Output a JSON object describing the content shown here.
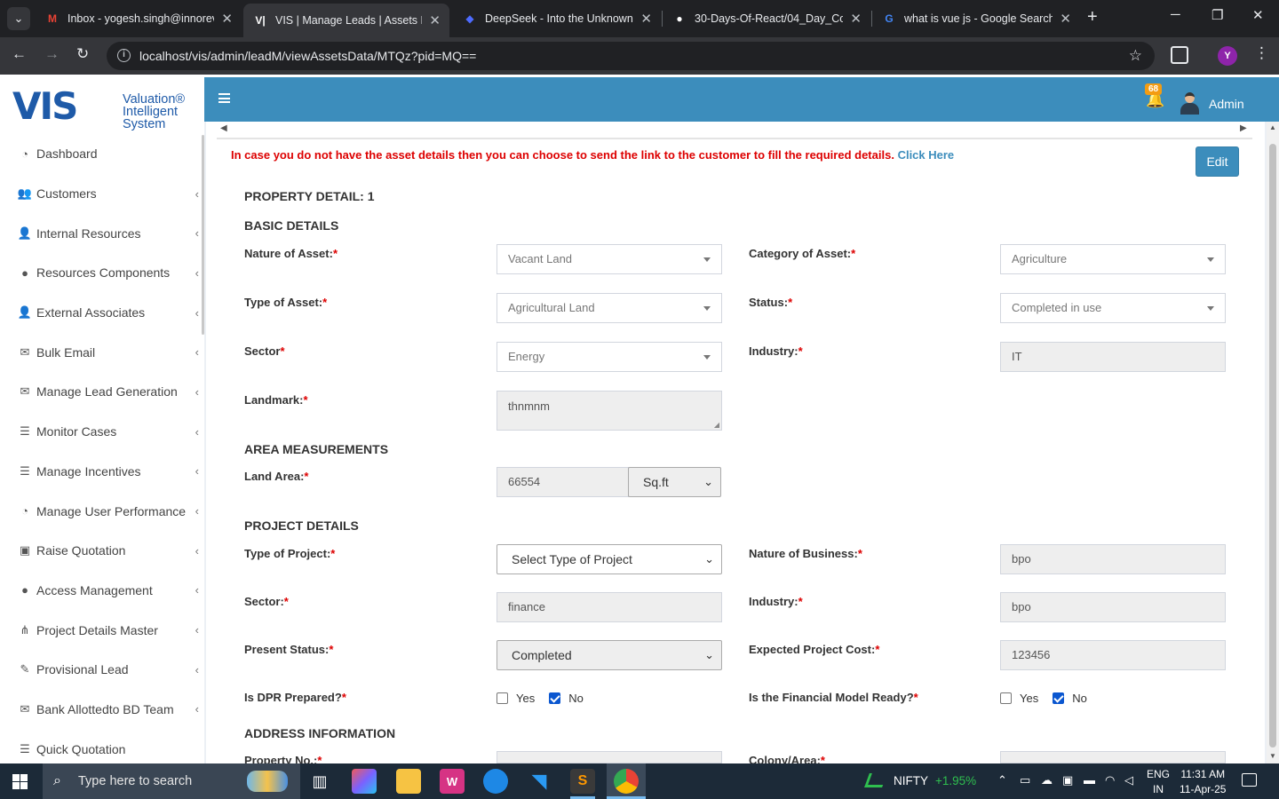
{
  "browser": {
    "tabs": [
      {
        "label": "Inbox - yogesh.singh@innorev",
        "icon": "gmail-icon"
      },
      {
        "label": "VIS | Manage Leads | Assets De",
        "icon": "vis-icon"
      },
      {
        "label": "DeepSeek - Into the Unknown",
        "icon": "deepseek-icon"
      },
      {
        "label": "30-Days-Of-React/04_Day_Com",
        "icon": "github-icon"
      },
      {
        "label": "what is vue js - Google Search",
        "icon": "google-icon"
      }
    ],
    "url": "localhost/vis/admin/leadM/viewAssetsData/MTQz?pid=MQ==",
    "profile_initial": "Y"
  },
  "logo": {
    "mark": "VIS",
    "line1": "Valuation®",
    "line2": "Intelligent",
    "line3": "System"
  },
  "sidebar": {
    "items": [
      {
        "label": "Dashboard",
        "icon": "dashboard-icon"
      },
      {
        "label": "Customers",
        "icon": "users-icon"
      },
      {
        "label": "Internal Resources",
        "icon": "user-plus-icon"
      },
      {
        "label": "Resources Components",
        "icon": "globe-icon"
      },
      {
        "label": "External Associates",
        "icon": "user-icon"
      },
      {
        "label": "Bulk Email",
        "icon": "envelope-icon"
      },
      {
        "label": "Manage Lead Generation",
        "icon": "envelope-icon"
      },
      {
        "label": "Monitor Cases",
        "icon": "list-icon"
      },
      {
        "label": "Manage Incentives",
        "icon": "list-icon"
      },
      {
        "label": "Manage User Performance",
        "icon": "dashboard-icon"
      },
      {
        "label": "Raise Quotation",
        "icon": "money-icon"
      },
      {
        "label": "Access Management",
        "icon": "globe-icon"
      },
      {
        "label": "Project Details Master",
        "icon": "sitemap-icon"
      },
      {
        "label": "Provisional Lead",
        "icon": "pen-icon"
      },
      {
        "label": "Bank Allottedto BD Team",
        "icon": "envelope-icon"
      },
      {
        "label": "Quick Quotation",
        "icon": "list-icon"
      }
    ]
  },
  "header": {
    "notification_count": "68",
    "user_name": "Admin"
  },
  "notice": {
    "text": "In case you do not have the asset details then you can choose to send the link to the customer to fill the required details.",
    "link": "Click Here"
  },
  "edit_label": "Edit",
  "property_title": "PROPERTY DETAIL: 1",
  "basic": {
    "title": "BASIC DETAILS",
    "nature_label": "Nature of Asset:",
    "nature_value": "Vacant Land",
    "category_label": "Category of Asset:",
    "category_value": "Agriculture",
    "type_label": "Type of Asset:",
    "type_value": "Agricultural Land",
    "status_label": "Status:",
    "status_value": "Completed in use",
    "sector_label": "Sector",
    "sector_value": "Energy",
    "industry_label": "Industry:",
    "industry_value": "IT",
    "landmark_label": "Landmark:",
    "landmark_value": "thnmnm"
  },
  "area": {
    "title": "AREA MEASUREMENTS",
    "land_label": "Land Area:",
    "land_value": "66554",
    "unit_value": "Sq.ft"
  },
  "project": {
    "title": "PROJECT DETAILS",
    "type_label": "Type of Project:",
    "type_value": "Select Type of Project",
    "business_label": "Nature of Business:",
    "business_value": "bpo",
    "sector_label": "Sector:",
    "sector_value": "finance",
    "industry_label": "Industry:",
    "industry_value": "bpo",
    "present_label": "Present Status:",
    "present_value": "Completed",
    "cost_label": "Expected Project Cost:",
    "cost_value": "123456",
    "dpr_label": "Is DPR Prepared?",
    "fin_label": "Is the Financial Model Ready?",
    "yes": "Yes",
    "no": "No",
    "dpr_selected": "No",
    "fin_selected": "No"
  },
  "address": {
    "title": "ADDRESS INFORMATION",
    "property_no_label": "Property No.:",
    "colony_label": "Colony/Area:"
  },
  "taskbar": {
    "search_placeholder": "Type here to search",
    "ticker_name": "NIFTY",
    "ticker_change": "+1.95%",
    "lang_line1": "ENG",
    "lang_line2": "IN",
    "time": "11:31 AM",
    "date": "11-Apr-25"
  }
}
